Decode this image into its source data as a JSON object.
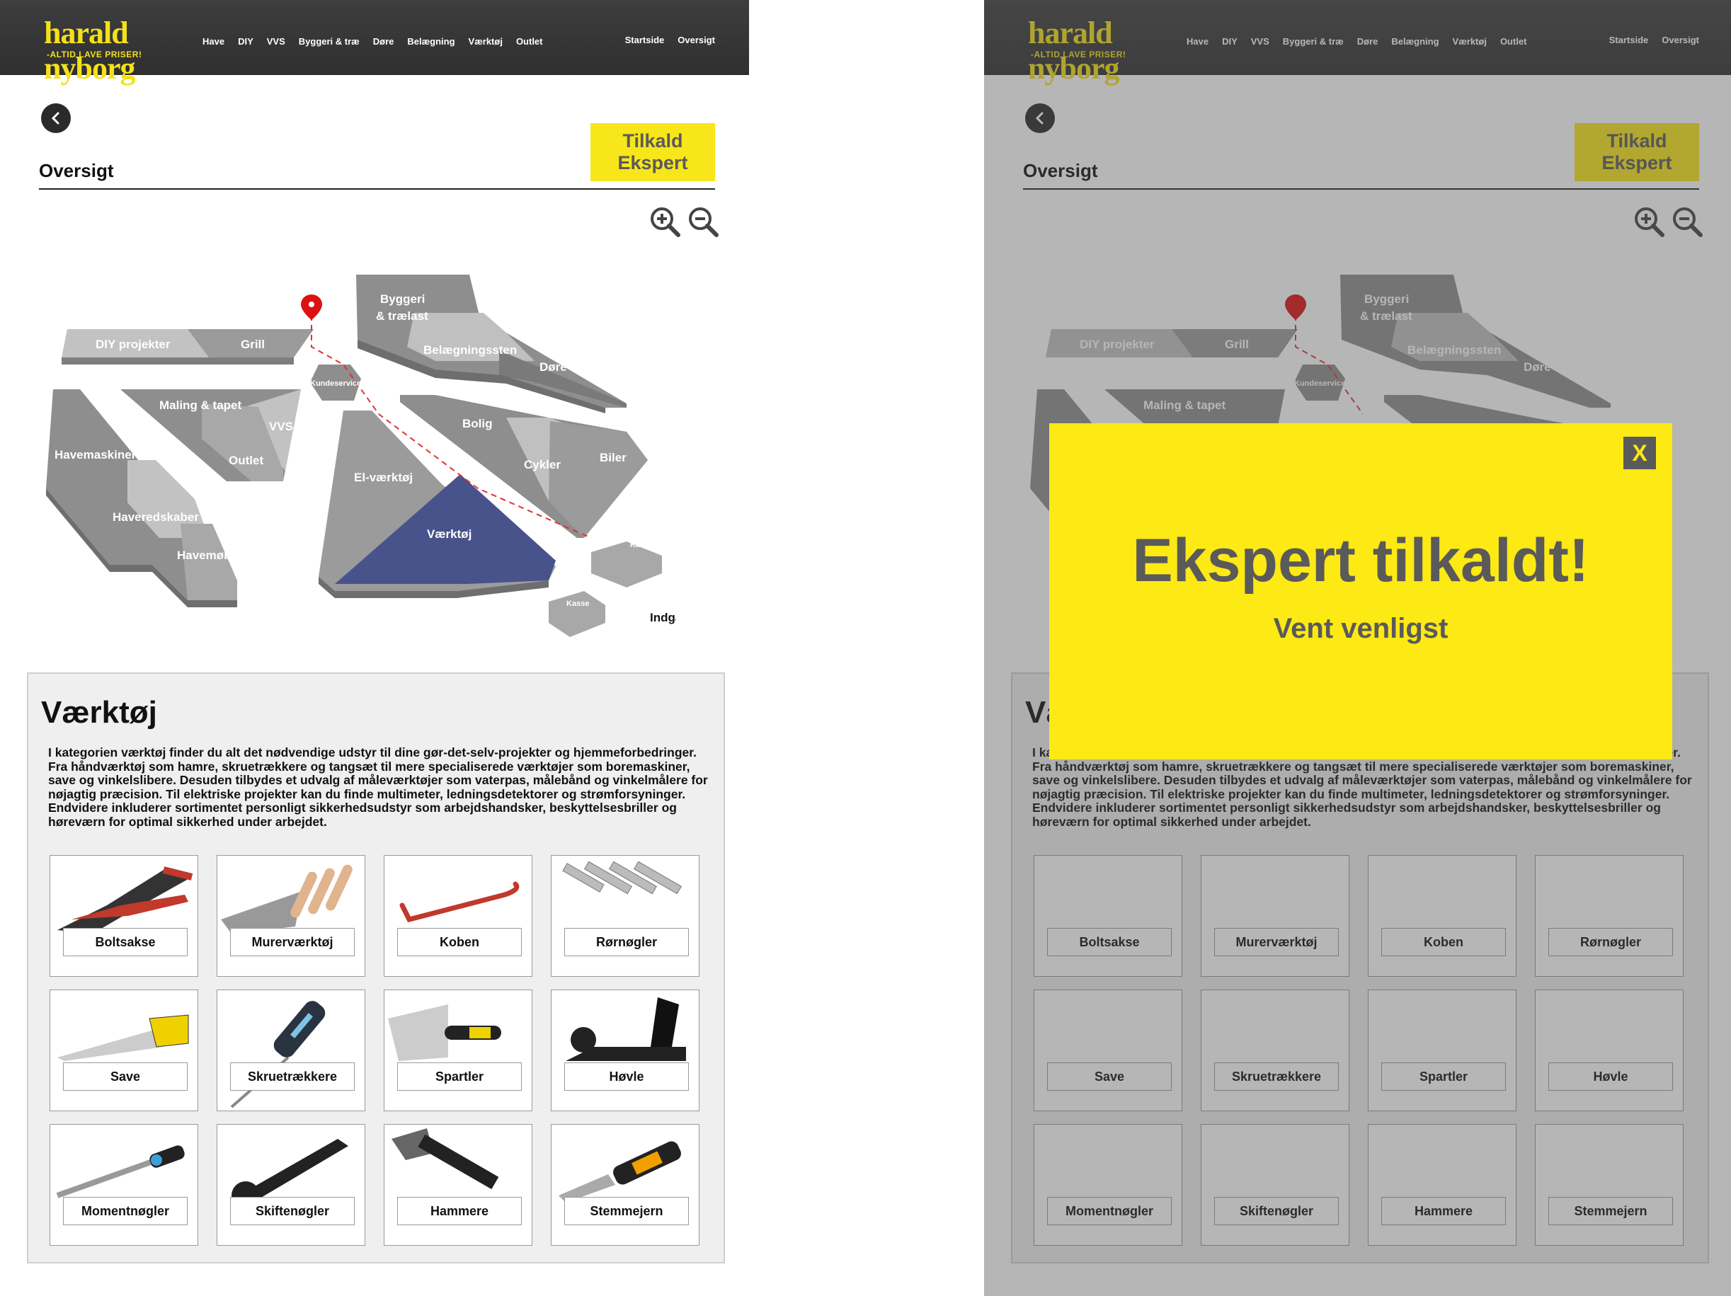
{
  "brand": {
    "name": "harald nyborg",
    "tagline": "-ALTID LAVE PRISER!"
  },
  "nav": {
    "items": [
      "Have",
      "DIY",
      "VVS",
      "Byggeri & træ",
      "Døre",
      "Belægning",
      "Værktøj",
      "Outlet"
    ],
    "right": [
      "Startside",
      "Oversigt"
    ]
  },
  "page": {
    "title": "Oversigt",
    "expert_button": [
      "Tilkald",
      "Ekspert"
    ]
  },
  "map": {
    "zones": [
      "DIY projekter",
      "Grill",
      "Byggeri",
      "& trælast",
      "Belægningssten",
      "Døre",
      "Kundeservice",
      "Maling & tapet",
      "VVS",
      "Outlet",
      "Havemaskiner",
      "Haveredskaber",
      "Havemøbler",
      "El-værktøj",
      "Værktøj",
      "Bolig",
      "Cykler",
      "Biler",
      "Kasse",
      "Kasse",
      "Indgang"
    ],
    "highlighted": "Værktøj",
    "highlight_color": "#46528c"
  },
  "category": {
    "title": "Værktøj",
    "description": "I kategorien værktøj finder du alt det nødvendige udstyr til dine gør-det-selv-projekter og hjemmeforbedringer. Fra håndværktøj som hamre, skruetrækkere og tangsæt til mere specialiserede værktøjer som boremaskiner, save og vinkelslibere. Desuden tilbydes et udvalg af måleværktøjer som vaterpas, målebånd og vinkelmålere for nøjagtig præcision. Til elektriske projekter kan du finde multimeter, ledningsdetektorer og strømforsyninger. Endvidere inkluderer sortimentet personligt sikkerhedsudstyr som arbejdshandsker, beskyttelsesbriller og høreværn for optimal sikkerhed under arbejdet.",
    "products": [
      "Boltsakse",
      "Murerværktøj",
      "Koben",
      "Rørnøgler",
      "Save",
      "Skruetrækkere",
      "Spartler",
      "Høvle",
      "Momentnøgler",
      "Skiftenøgler",
      "Hammere",
      "Stemmejern"
    ]
  },
  "modal": {
    "title": "Ekspert tilkaldt!",
    "subtitle": "Vent venligst",
    "close": "X"
  },
  "colors": {
    "accent": "#f7e61a",
    "nav_bg": "#333333",
    "modal_bg": "#fde914",
    "text_gray": "#5a5a5a"
  }
}
